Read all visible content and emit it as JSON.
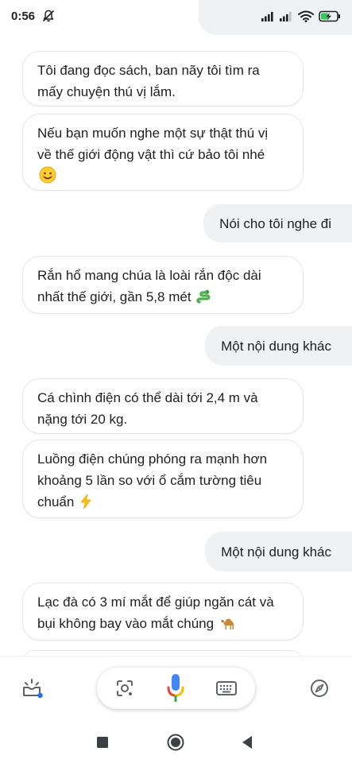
{
  "status_bar": {
    "time": "0:56",
    "icons": [
      "notifications-off-icon",
      "signal-icon",
      "signal-icon",
      "wifi-icon",
      "battery-charging-icon"
    ]
  },
  "messages": [
    {
      "from": "assistant",
      "lines": [
        "Tôi đang đọc sách, ban nãy tôi tìm ra",
        "mấy chuyện thú vị lắm."
      ],
      "emoji": ""
    },
    {
      "from": "assistant",
      "lines": [
        "Nếu bạn muốn nghe một sự thật thú vị",
        "về thế giới động vật thì cứ bảo tôi nhé"
      ],
      "emoji": "smiling-face-emoji"
    },
    {
      "from": "user",
      "text": "Nói cho tôi nghe đi"
    },
    {
      "from": "assistant",
      "lines": [
        "Rắn hổ mang chúa là loài rắn độc dài",
        "nhất thế giới, gần 5,8 mét"
      ],
      "emoji": "snake-emoji"
    },
    {
      "from": "user",
      "text": "Một nội dung khác"
    },
    {
      "from": "assistant",
      "lines": [
        "Cá chình điện có thể dài tới 2,4 m và",
        "nặng tới 20 kg."
      ],
      "emoji": ""
    },
    {
      "from": "assistant",
      "lines": [
        "Luồng điện chúng phóng ra mạnh hơn",
        "khoảng 5 lần so với ổ cắm tường tiêu",
        "chuẩn"
      ],
      "emoji": "lightning-emoji"
    },
    {
      "from": "user",
      "text": "Một nội dung khác"
    },
    {
      "from": "assistant",
      "lines": [
        "Lạc đà có 3 mí mắt để giúp ngăn cát và",
        "bụi không bay vào mắt chúng"
      ],
      "emoji": "camel-emoji"
    }
  ],
  "action_bar": {
    "icons": [
      "snapshot-icon",
      "lens-icon",
      "microphone-icon",
      "keyboard-icon",
      "explore-compass-icon"
    ]
  },
  "nav_bar": {
    "icons": [
      "recents-square-icon",
      "home-circle-icon",
      "back-triangle-icon"
    ]
  },
  "colors": {
    "user_bubble": "#f0f1f3",
    "assistant_border": "#e4e6ea",
    "mic_blue": "#4285f4",
    "mic_red": "#ea4335",
    "mic_yellow": "#fbbc05",
    "mic_green": "#34a853"
  }
}
